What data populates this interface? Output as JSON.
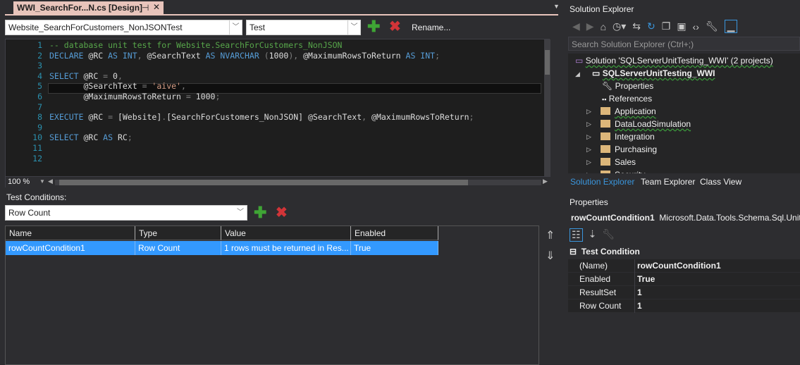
{
  "document_tab": {
    "title": "WWI_SearchFor...N.cs [Design]",
    "pin_icon": "pin-icon",
    "close_icon": "close-icon"
  },
  "toolbar": {
    "test_select": "Website_SearchForCustomers_NonJSONTest",
    "script_select": "Test",
    "rename_label": "Rename..."
  },
  "editor": {
    "lines": [
      {
        "n": "1",
        "tokens": [
          [
            "cm",
            "-- database unit test for Website.SearchForCustomers_NonJSON"
          ]
        ]
      },
      {
        "n": "2",
        "tokens": [
          [
            "kw",
            "DECLARE "
          ],
          [
            "id",
            "@RC "
          ],
          [
            "kw",
            "AS INT"
          ],
          [
            "op",
            ", "
          ],
          [
            "id",
            "@SearchText "
          ],
          [
            "kw",
            "AS NVARCHAR "
          ],
          [
            "op",
            "("
          ],
          [
            "pl",
            "1000"
          ],
          [
            "op",
            "), "
          ],
          [
            "id",
            "@MaximumRowsToReturn "
          ],
          [
            "kw",
            "AS INT"
          ],
          [
            "op",
            ";"
          ]
        ]
      },
      {
        "n": "3",
        "tokens": []
      },
      {
        "n": "4",
        "tokens": [
          [
            "kw",
            "SELECT "
          ],
          [
            "id",
            "@RC "
          ],
          [
            "op",
            "= "
          ],
          [
            "pl",
            "0"
          ],
          [
            "op",
            ","
          ]
        ]
      },
      {
        "n": "5",
        "tokens": [
          [
            "pl",
            "       "
          ],
          [
            "id",
            "@SearchText "
          ],
          [
            "op",
            "= "
          ],
          [
            "st",
            "'aive'"
          ],
          [
            "op",
            ","
          ]
        ]
      },
      {
        "n": "6",
        "tokens": [
          [
            "pl",
            "       "
          ],
          [
            "id",
            "@MaximumRowsToReturn "
          ],
          [
            "op",
            "= "
          ],
          [
            "pl",
            "1000"
          ],
          [
            "op",
            ";"
          ]
        ]
      },
      {
        "n": "7",
        "tokens": []
      },
      {
        "n": "8",
        "tokens": [
          [
            "kw",
            "EXECUTE "
          ],
          [
            "id",
            "@RC "
          ],
          [
            "op",
            "= "
          ],
          [
            "id",
            "[Website]"
          ],
          [
            "op",
            "."
          ],
          [
            "id",
            "[SearchForCustomers_NonJSON] @SearchText"
          ],
          [
            "op",
            ", "
          ],
          [
            "id",
            "@MaximumRowsToReturn"
          ],
          [
            "op",
            ";"
          ]
        ]
      },
      {
        "n": "9",
        "tokens": []
      },
      {
        "n": "10",
        "tokens": [
          [
            "kw",
            "SELECT "
          ],
          [
            "id",
            "@RC "
          ],
          [
            "kw",
            "AS "
          ],
          [
            "id",
            "RC"
          ],
          [
            "op",
            ";"
          ]
        ]
      },
      {
        "n": "11",
        "tokens": []
      },
      {
        "n": "12",
        "tokens": []
      }
    ],
    "zoom_level": "100 %"
  },
  "test_conditions": {
    "label": "Test Conditions:",
    "type_select": "Row Count",
    "columns": [
      "Name",
      "Type",
      "Value",
      "Enabled"
    ],
    "rows": [
      [
        "rowCountCondition1",
        "Row Count",
        "1 rows must be returned in Res...",
        "True"
      ]
    ]
  },
  "solution_explorer": {
    "title": "Solution Explorer",
    "search_placeholder": "Search Solution Explorer (Ctrl+;)",
    "solution": "Solution 'SQLServerUnitTesting_WWI' (2 projects)",
    "project": "SQLServerUnitTesting_WWI",
    "items": [
      "Properties",
      "References"
    ],
    "folders": [
      "Application",
      "DataLoadSimulation",
      "Integration",
      "Purchasing",
      "Sales",
      "Security"
    ],
    "tabs": [
      "Solution Explorer",
      "Team Explorer",
      "Class View"
    ]
  },
  "properties": {
    "title": "Properties",
    "object_name": "rowCountCondition1",
    "object_type": "Microsoft.Data.Tools.Schema.Sql.UnitT",
    "category": "Test Condition",
    "rows": [
      [
        "(Name)",
        "rowCountCondition1"
      ],
      [
        "Enabled",
        "True"
      ],
      [
        "ResultSet",
        "1"
      ],
      [
        "Row Count",
        "1"
      ]
    ]
  },
  "colors": {
    "accent": "#3399ff",
    "tab": "#e8c4bb",
    "background": "#2d2d30",
    "editor": "#1e1e1e"
  }
}
